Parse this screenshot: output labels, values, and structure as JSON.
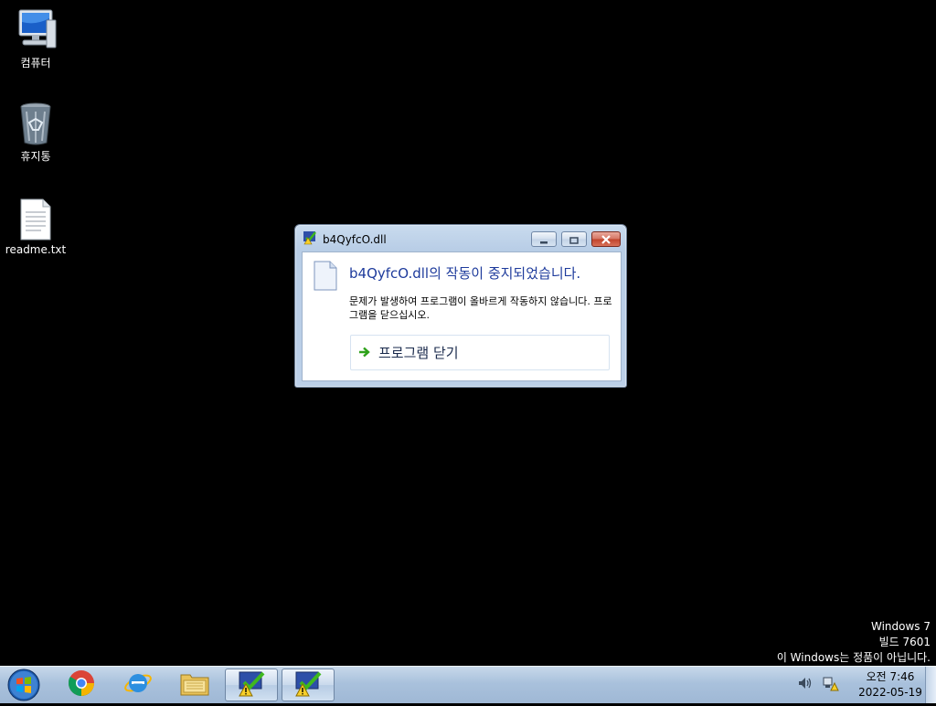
{
  "desktop": {
    "icons": [
      {
        "label": "컴퓨터",
        "icon": "computer-icon"
      },
      {
        "label": "휴지통",
        "icon": "recycle-bin-icon"
      },
      {
        "label": "readme.txt",
        "icon": "text-file-icon"
      }
    ]
  },
  "dialog": {
    "title": "b4QyfcO.dll",
    "heading": "b4QyfcO.dll의 작동이 중지되었습니다.",
    "message": "문제가 발생하여 프로그램이 올바르게 작동하지 않습니다. 프로그램을 닫으십시오.",
    "action_label": "프로그램 닫기",
    "buttons": [
      "minimize-icon",
      "maximize-icon",
      "close-icon"
    ]
  },
  "watermark": {
    "line1": "Windows 7",
    "line2": "빌드 7601",
    "line3": "이 Windows는 정품이 아닙니다."
  },
  "taskbar": {
    "pinned": [
      "start-orb-icon",
      "chrome-icon",
      "internet-explorer-icon",
      "file-explorer-icon",
      "program-warning-icon",
      "program-warning-icon"
    ],
    "clock_time": "오전 7:46",
    "clock_date": "2022-05-19",
    "tray_icons": [
      "speaker-icon",
      "network-warning-icon"
    ]
  },
  "colors": {
    "heading": "#1e3b9c",
    "close_button": "#c0432a",
    "taskbar": "#a9c1dc"
  }
}
